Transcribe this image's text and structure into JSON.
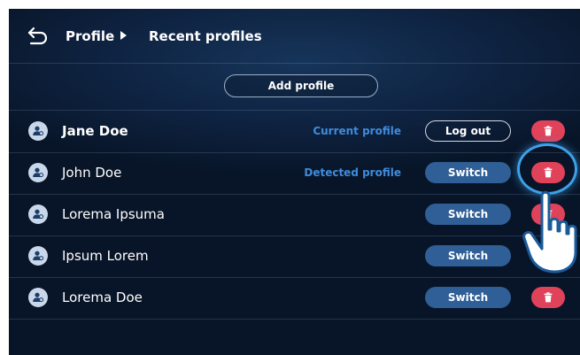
{
  "header": {
    "breadcrumb": [
      "Profile",
      "Recent profiles"
    ]
  },
  "add_profile_label": "Add profile",
  "profiles": [
    {
      "name": "Jane Doe",
      "status": "Current profile",
      "action": "Log out",
      "current": true
    },
    {
      "name": "John Doe",
      "status": "Detected profile",
      "action": "Switch",
      "current": false
    },
    {
      "name": "Lorema Ipsuma",
      "status": "",
      "action": "Switch",
      "current": false
    },
    {
      "name": "Ipsum Lorem",
      "status": "",
      "action": "Switch",
      "current": false
    },
    {
      "name": "Lorema Doe",
      "status": "",
      "action": "Switch",
      "current": false
    }
  ],
  "colors": {
    "background": "#0b1c35",
    "status_text": "#3f8bdc",
    "switch_button": "#2f5f96",
    "delete_button": "#e0425a",
    "focus_ring": "#3ea0e8"
  },
  "icons": {
    "back": "back-arrow-icon",
    "breadcrumb_separator": "chevron-right-icon",
    "avatar": "user-profile-icon",
    "delete": "trash-icon",
    "pointer": "tap-hand-icon"
  }
}
